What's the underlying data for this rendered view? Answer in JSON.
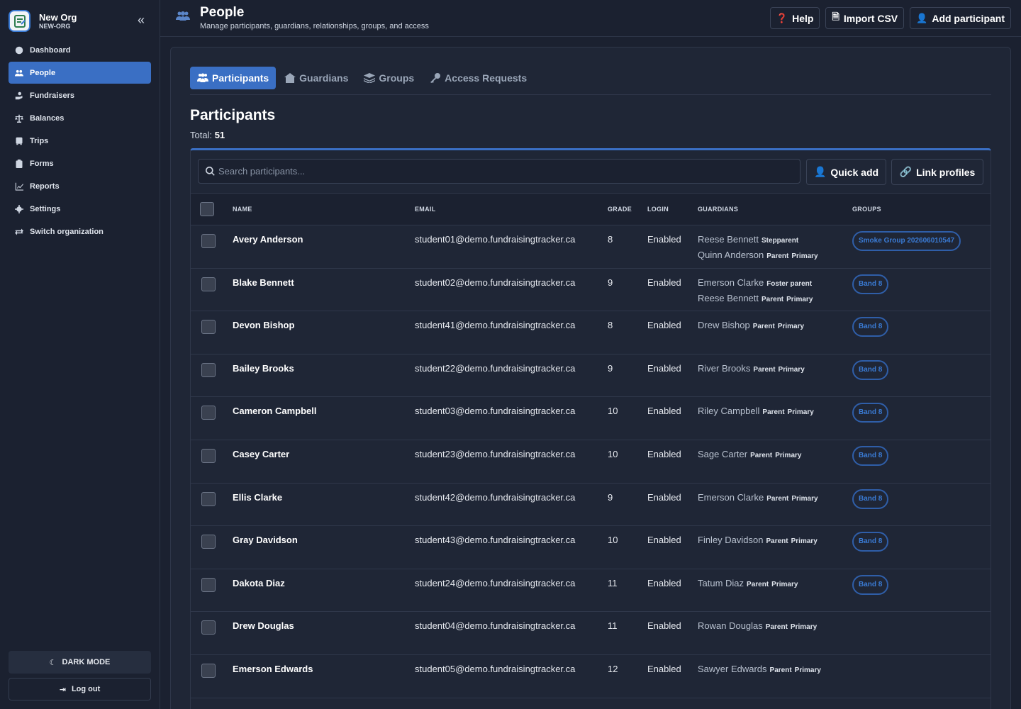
{
  "org": {
    "name": "New Org",
    "slug": "NEW-ORG"
  },
  "sidebar": {
    "items": [
      {
        "label": "Dashboard"
      },
      {
        "label": "People"
      },
      {
        "label": "Fundraisers"
      },
      {
        "label": "Balances"
      },
      {
        "label": "Trips"
      },
      {
        "label": "Forms"
      },
      {
        "label": "Reports"
      },
      {
        "label": "Settings"
      },
      {
        "label": "Switch organization"
      }
    ],
    "dark_mode_label": "DARK MODE",
    "logout_label": "Log out"
  },
  "header": {
    "title": "People",
    "subtitle": "Manage participants, guardians, relationships, groups, and access",
    "help_label": "Help",
    "import_label": "Import CSV",
    "add_label": "Add participant"
  },
  "tabs": [
    {
      "label": "Participants"
    },
    {
      "label": "Guardians"
    },
    {
      "label": "Groups"
    },
    {
      "label": "Access Requests"
    }
  ],
  "section": {
    "title": "Participants",
    "total_label": "Total:",
    "total_value": "51"
  },
  "toolbar": {
    "search_placeholder": "Search participants...",
    "quick_add_label": "Quick add",
    "link_profiles_label": "Link profiles"
  },
  "table": {
    "columns": [
      "NAME",
      "EMAIL",
      "GRADE",
      "LOGIN",
      "GUARDIANS",
      "GROUPS"
    ],
    "rows": [
      {
        "name": "Avery Anderson",
        "email": "student01@demo.fundraisingtracker.ca",
        "grade": "8",
        "login": "Enabled",
        "g1_name": "Reese Bennett",
        "g1_rel": "Stepparent",
        "g1_pri": "",
        "g2_name": "Quinn Anderson",
        "g2_rel": "Parent",
        "g2_pri": "Primary",
        "group": "Smoke Group 202606010547"
      },
      {
        "name": "Blake Bennett",
        "email": "student02@demo.fundraisingtracker.ca",
        "grade": "9",
        "login": "Enabled",
        "g1_name": "Emerson Clarke",
        "g1_rel": "Foster parent",
        "g1_pri": "",
        "g2_name": "Reese Bennett",
        "g2_rel": "Parent",
        "g2_pri": "Primary",
        "group": "Band 8"
      },
      {
        "name": "Devon Bishop",
        "email": "student41@demo.fundraisingtracker.ca",
        "grade": "8",
        "login": "Enabled",
        "g1_name": "Drew Bishop",
        "g1_rel": "Parent",
        "g1_pri": "Primary",
        "g2_name": "",
        "g2_rel": "",
        "g2_pri": "",
        "group": "Band 8"
      },
      {
        "name": "Bailey Brooks",
        "email": "student22@demo.fundraisingtracker.ca",
        "grade": "9",
        "login": "Enabled",
        "g1_name": "River Brooks",
        "g1_rel": "Parent",
        "g1_pri": "Primary",
        "g2_name": "",
        "g2_rel": "",
        "g2_pri": "",
        "group": "Band 8"
      },
      {
        "name": "Cameron Campbell",
        "email": "student03@demo.fundraisingtracker.ca",
        "grade": "10",
        "login": "Enabled",
        "g1_name": "Riley Campbell",
        "g1_rel": "Parent",
        "g1_pri": "Primary",
        "g2_name": "",
        "g2_rel": "",
        "g2_pri": "",
        "group": "Band 8"
      },
      {
        "name": "Casey Carter",
        "email": "student23@demo.fundraisingtracker.ca",
        "grade": "10",
        "login": "Enabled",
        "g1_name": "Sage Carter",
        "g1_rel": "Parent",
        "g1_pri": "Primary",
        "g2_name": "",
        "g2_rel": "",
        "g2_pri": "",
        "group": "Band 8"
      },
      {
        "name": "Ellis Clarke",
        "email": "student42@demo.fundraisingtracker.ca",
        "grade": "9",
        "login": "Enabled",
        "g1_name": "Emerson Clarke",
        "g1_rel": "Parent",
        "g1_pri": "Primary",
        "g2_name": "",
        "g2_rel": "",
        "g2_pri": "",
        "group": "Band 8"
      },
      {
        "name": "Gray Davidson",
        "email": "student43@demo.fundraisingtracker.ca",
        "grade": "10",
        "login": "Enabled",
        "g1_name": "Finley Davidson",
        "g1_rel": "Parent",
        "g1_pri": "Primary",
        "g2_name": "",
        "g2_rel": "",
        "g2_pri": "",
        "group": "Band 8"
      },
      {
        "name": "Dakota Diaz",
        "email": "student24@demo.fundraisingtracker.ca",
        "grade": "11",
        "login": "Enabled",
        "g1_name": "Tatum Diaz",
        "g1_rel": "Parent",
        "g1_pri": "Primary",
        "g2_name": "",
        "g2_rel": "",
        "g2_pri": "",
        "group": "Band 8"
      },
      {
        "name": "Drew Douglas",
        "email": "student04@demo.fundraisingtracker.ca",
        "grade": "11",
        "login": "Enabled",
        "g1_name": "Rowan Douglas",
        "g1_rel": "Parent",
        "g1_pri": "Primary",
        "g2_name": "",
        "g2_rel": "",
        "g2_pri": "",
        "group": ""
      },
      {
        "name": "Emerson Edwards",
        "email": "student05@demo.fundraisingtracker.ca",
        "grade": "12",
        "login": "Enabled",
        "g1_name": "Sawyer Edwards",
        "g1_rel": "Parent",
        "g1_pri": "Primary",
        "g2_name": "",
        "g2_rel": "",
        "g2_pri": "",
        "group": ""
      }
    ]
  },
  "colors": {
    "accent": "#3a6fc4",
    "background": "#1b2130",
    "card": "#1f2636",
    "pill_text": "#3a7bd5"
  }
}
